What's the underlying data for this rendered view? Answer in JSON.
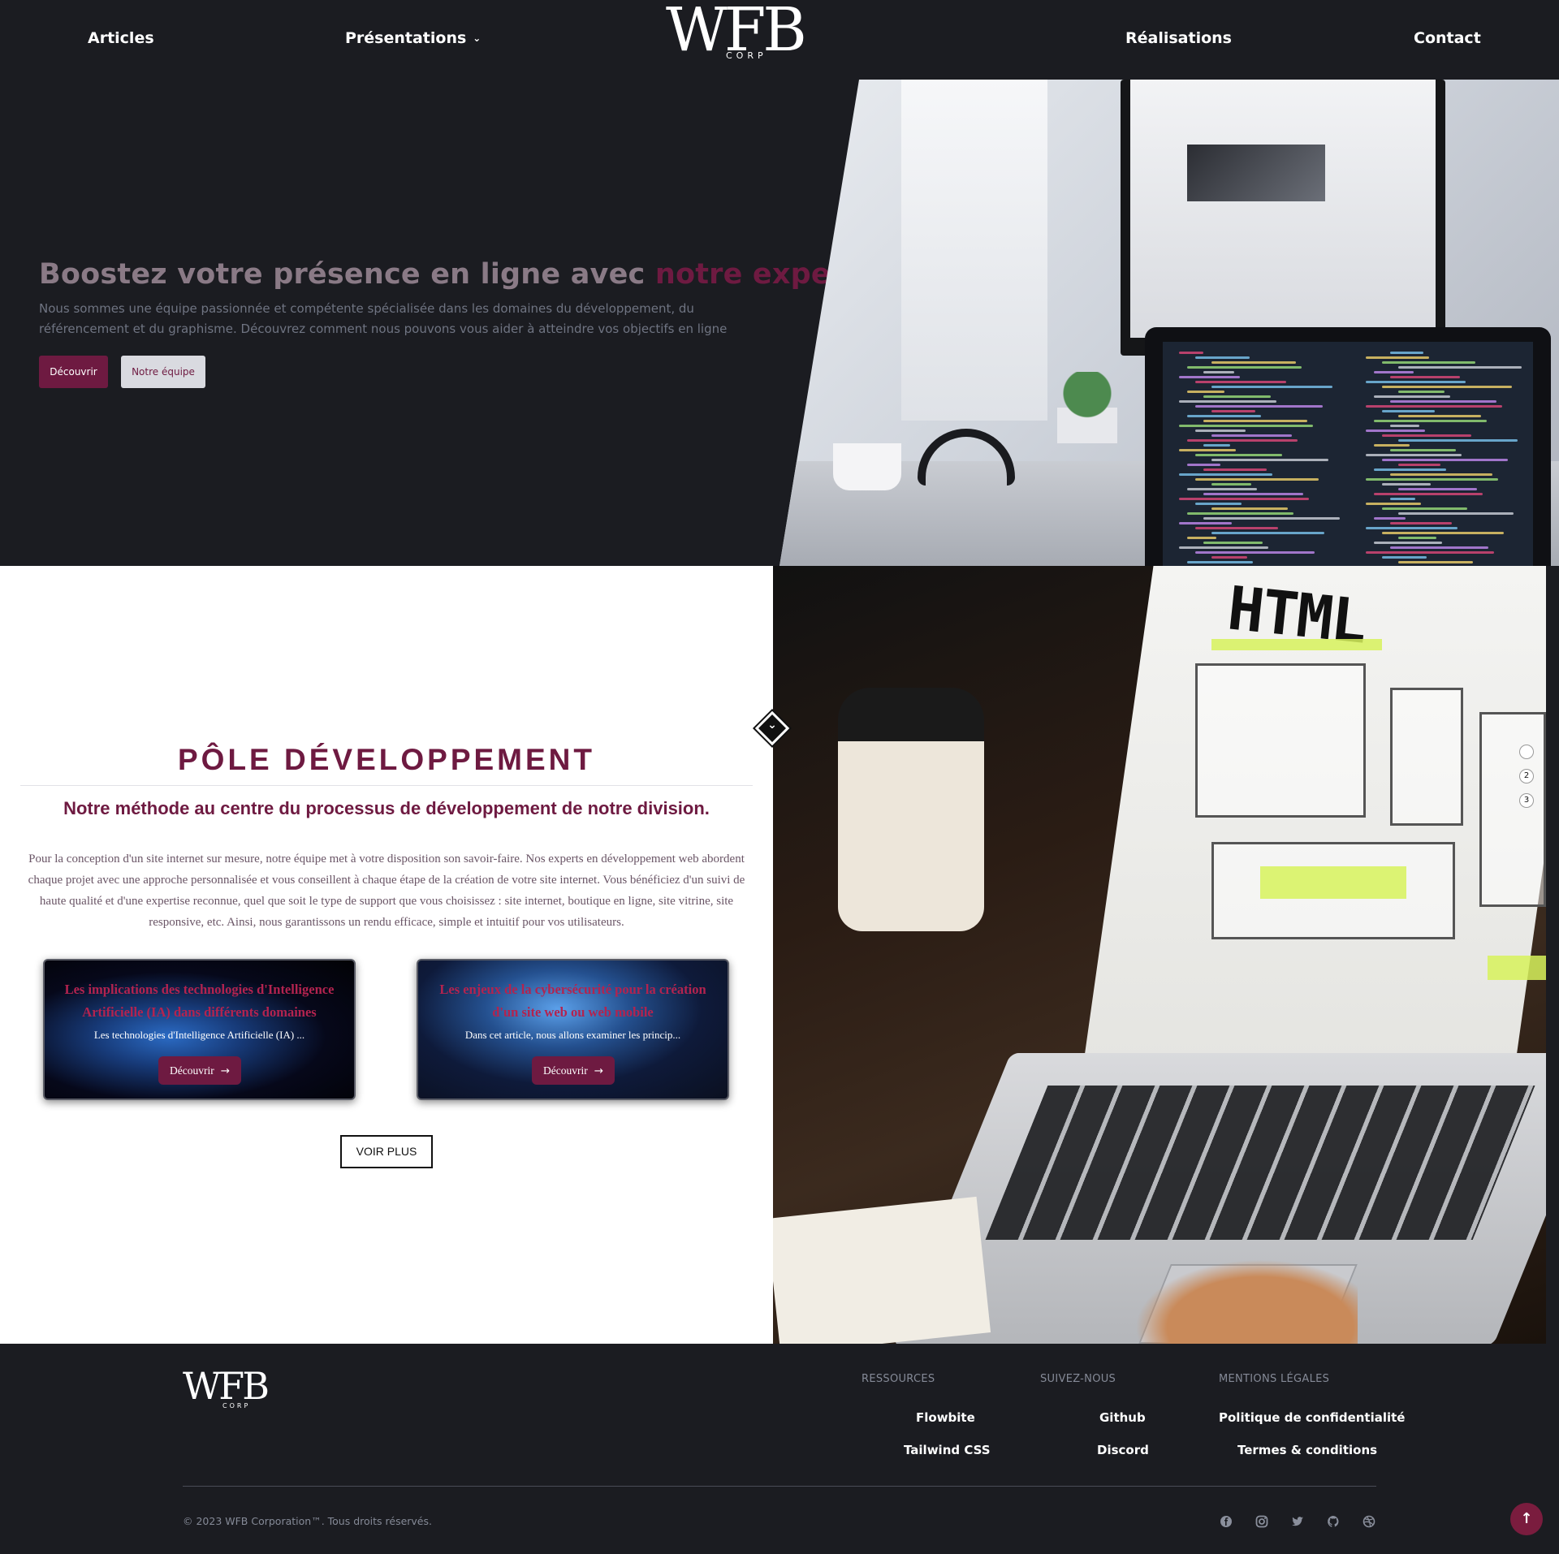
{
  "nav": {
    "articles": "Articles",
    "presentations": "Présentations",
    "realisations": "Réalisations",
    "contact": "Contact"
  },
  "logo": {
    "mark": "WFB",
    "sub": "CORP"
  },
  "hero": {
    "title_main": "Boostez votre présence en ligne avec ",
    "title_accent": "notre expertise",
    "text": "Nous sommes une équipe passionnée et compétente spécialisée dans les domaines du développement, du référencement et du graphisme. Découvrez comment nous pouvons vous aider à atteindre vos objectifs en ligne",
    "btn_primary": "Découvrir",
    "btn_secondary": "Notre équipe"
  },
  "dev": {
    "title": "PÔLE DÉVELOPPEMENT",
    "subtitle": "Notre méthode au centre du processus de développement de notre division.",
    "text": "Pour la conception d'un site internet sur mesure, notre équipe met à votre disposition son savoir-faire. Nos experts en développement web abordent chaque projet avec une approche personnalisée et vous conseillent à chaque étape de la création de votre site internet. Vous bénéficiez d'un suivi de haute qualité et d'une expertise reconnue, quel que soit le type de support que vous choisissez : site internet, boutique en ligne, site vitrine, site responsive, etc. Ainsi, nous garantissons un rendu efficace, simple et intuitif pour vos utilisateurs.",
    "cards": [
      {
        "title": "Les implications des technologies d'Intelligence Artificielle (IA) dans différents domaines",
        "desc": "Les technologies d'Intelligence Artificielle (IA) ...",
        "button": "Découvrir"
      },
      {
        "title": "Les enjeux de la cybersécurité pour la création d'un site web ou web mobile",
        "desc": "Dans cet article, nous allons examiner les princip...",
        "button": "Découvrir"
      }
    ],
    "voir_plus": "VOIR PLUS",
    "image_text": "HTML"
  },
  "scroll_dots": [
    "",
    "2",
    "3"
  ],
  "footer": {
    "logo_mark": "WFB",
    "logo_sub": "CORP",
    "ressources": {
      "head": "RESSOURCES",
      "links": [
        "Flowbite",
        "Tailwind CSS"
      ]
    },
    "suivez": {
      "head": "SUIVEZ-NOUS",
      "links": [
        "Github",
        "Discord"
      ]
    },
    "mentions": {
      "head": "MENTIONS LÉGALES",
      "links": [
        "Politique de confidentialité",
        "Termes & conditions"
      ]
    },
    "copyright": "© 2023 WFB Corporation™. Tous droits réservés.",
    "social_icons": [
      "facebook-icon",
      "instagram-icon",
      "twitter-icon",
      "github-icon",
      "dribbble-icon"
    ]
  },
  "colors": {
    "background": "#1b1c21",
    "accent": "#6e1a41",
    "card_title": "#b3234f",
    "muted": "#858a97"
  }
}
